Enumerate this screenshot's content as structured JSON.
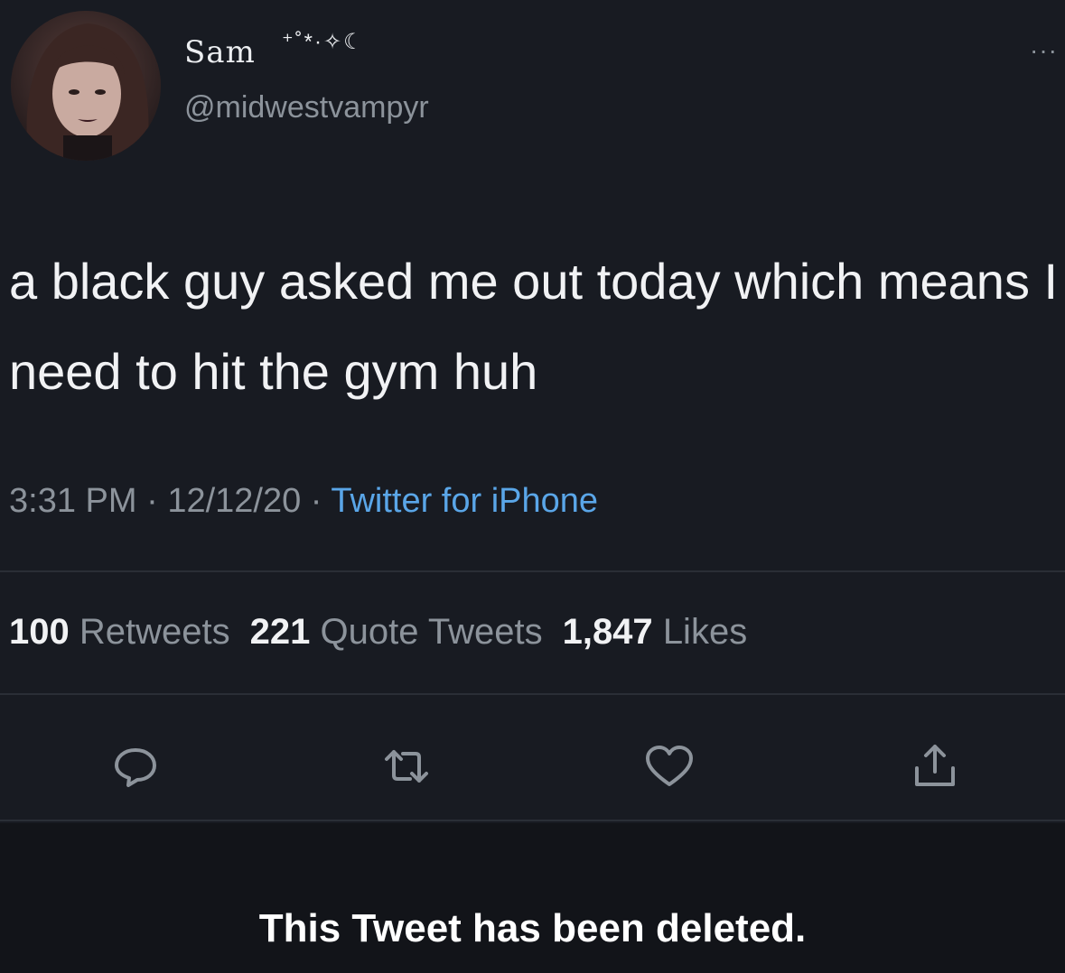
{
  "user": {
    "display_name": "Sam",
    "name_decoration": "⁺˚*·✧☾",
    "handle": "@midwestvampyr"
  },
  "tweet": {
    "text": "a black guy asked me out today which means I need to hit the gym huh",
    "time": "3:31 PM",
    "date": "12/12/20",
    "source": "Twitter for iPhone",
    "separator": " · "
  },
  "stats": {
    "retweets_count": "100",
    "retweets_label": "Retweets",
    "quotes_count": "221",
    "quotes_label": "Quote Tweets",
    "likes_count": "1,847",
    "likes_label": "Likes"
  },
  "icons": {
    "reply": "reply-icon",
    "retweet": "retweet-icon",
    "like": "heart-icon",
    "share": "share-icon",
    "more": "more-icon"
  },
  "banner": {
    "text": "This Tweet has been deleted."
  },
  "colors": {
    "background": "#181b22",
    "link": "#5aa6e8",
    "secondary_text": "#8c939b",
    "primary_text": "#f1f2f4"
  }
}
